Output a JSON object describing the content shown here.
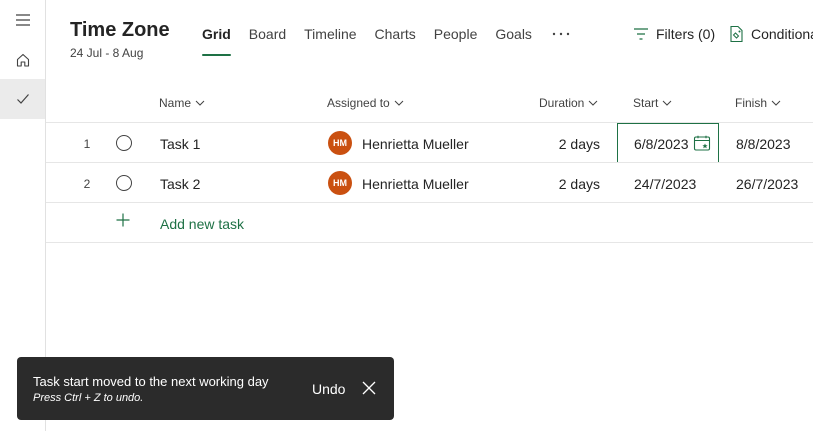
{
  "plan": {
    "title": "Time Zone",
    "dates": "24 Jul - 8 Aug"
  },
  "tabs": [
    {
      "label": "Grid",
      "active": true
    },
    {
      "label": "Board",
      "active": false
    },
    {
      "label": "Timeline",
      "active": false
    },
    {
      "label": "Charts",
      "active": false
    },
    {
      "label": "People",
      "active": false
    },
    {
      "label": "Goals",
      "active": false
    }
  ],
  "toolbar": {
    "more_icon": "ellipsis-icon",
    "filters_label": "Filters (0)",
    "conditions_label": "Conditional"
  },
  "columns": {
    "name": "Name",
    "assigned": "Assigned to",
    "duration": "Duration",
    "start": "Start",
    "finish": "Finish"
  },
  "tasks": [
    {
      "num": "1",
      "name": "Task 1",
      "initials": "HM",
      "assignee": "Henrietta Mueller",
      "duration": "2 days",
      "start": "6/8/2023",
      "finish": "8/8/2023"
    },
    {
      "num": "2",
      "name": "Task 2",
      "initials": "HM",
      "assignee": "Henrietta Mueller",
      "duration": "2 days",
      "start": "24/7/2023",
      "finish": "26/7/2023"
    }
  ],
  "add_task_label": "Add new task",
  "toast": {
    "message": "Task start moved to the next working day",
    "hint": "Press Ctrl + Z to undo.",
    "undo_label": "Undo"
  },
  "colors": {
    "accent": "#1e7145",
    "avatar": "#ca5010",
    "toast_bg": "#2b2b2b"
  }
}
